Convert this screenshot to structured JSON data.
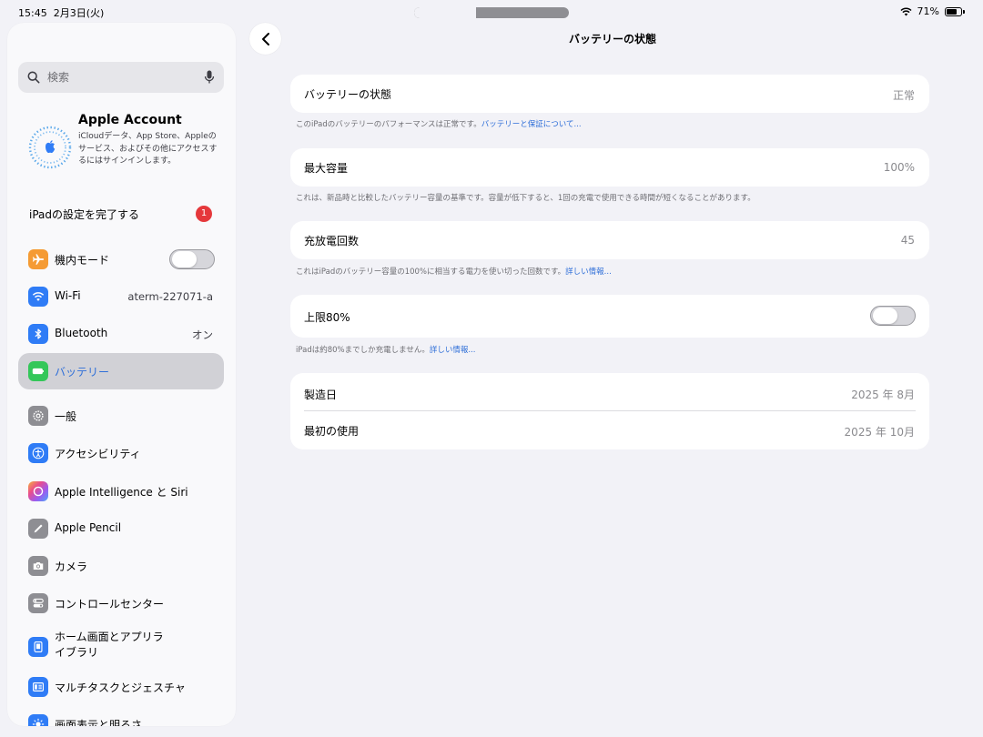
{
  "status_bar": {
    "time": "15:45",
    "date": "2月3日(火)",
    "battery": "71%",
    "battery_level": 0.71
  },
  "sidebar": {
    "search_placeholder": "検索",
    "account": {
      "name": "Apple Account",
      "description": "iCloudデータ、App Store、Appleのサービス、およびその他にアクセスするにはサインインします。"
    },
    "setup": {
      "label": "iPadの設定を完了する",
      "badge": "1"
    },
    "items": [
      {
        "label": "機内モード",
        "icon": "airplane-icon",
        "color": "#f59b34",
        "toggle": false
      },
      {
        "label": "Wi-Fi",
        "value": "aterm-227071-a",
        "icon": "wifi-icon",
        "color": "#2f7cf6"
      },
      {
        "label": "Bluetooth",
        "value": "オン",
        "icon": "bluetooth-icon",
        "color": "#2f7cf6"
      },
      {
        "label": "バッテリー",
        "icon": "battery-icon",
        "color": "#34c759",
        "selected": true
      },
      {
        "label": "一般",
        "icon": "gear-icon",
        "color": "#8e8e93"
      },
      {
        "label": "アクセシビリティ",
        "icon": "accessibility-icon",
        "color": "#2f7cf6"
      },
      {
        "label": "Apple Intelligence と Siri",
        "icon": "siri-icon",
        "color": "#c56ee8"
      },
      {
        "label": "Apple Pencil",
        "icon": "pencil-icon",
        "color": "#8e8e93"
      },
      {
        "label": "カメラ",
        "icon": "camera-icon",
        "color": "#8e8e93"
      },
      {
        "label": "コントロールセンター",
        "icon": "control-center-icon",
        "color": "#8e8e93"
      },
      {
        "label": "ホーム画面とアプリライブラリ",
        "icon": "home-screen-icon",
        "color": "#2f7cf6"
      },
      {
        "label": "マルチタスクとジェスチャ",
        "icon": "multitask-icon",
        "color": "#2f7cf6"
      },
      {
        "label": "画面表示と明るさ",
        "icon": "brightness-icon",
        "color": "#2f7cf6"
      }
    ]
  },
  "main": {
    "title": "バッテリーの状態",
    "condition": {
      "label": "バッテリーの状態",
      "value": "正常",
      "note": "このiPadのバッテリーのパフォーマンスは正常です。",
      "link": "バッテリーと保証について..."
    },
    "capacity": {
      "label": "最大容量",
      "value": "100%",
      "note": "これは、新品時と比較したバッテリー容量の基準です。容量が低下すると、1回の充電で使用できる時間が短くなることがあります。"
    },
    "cycles": {
      "label": "充放電回数",
      "value": "45",
      "note": "これはiPadのバッテリー容量の100%に相当する電力を使い切った回数です。",
      "link": "詳しい情報..."
    },
    "limit": {
      "label": "上限80%",
      "enabled": false,
      "note": "iPadは約80%までしか充電しません。",
      "link": "詳しい情報..."
    },
    "dates": {
      "manufacture_label": "製造日",
      "manufacture_value": "2025 年 8月",
      "first_use_label": "最初の使用",
      "first_use_value": "2025 年 10月"
    }
  }
}
